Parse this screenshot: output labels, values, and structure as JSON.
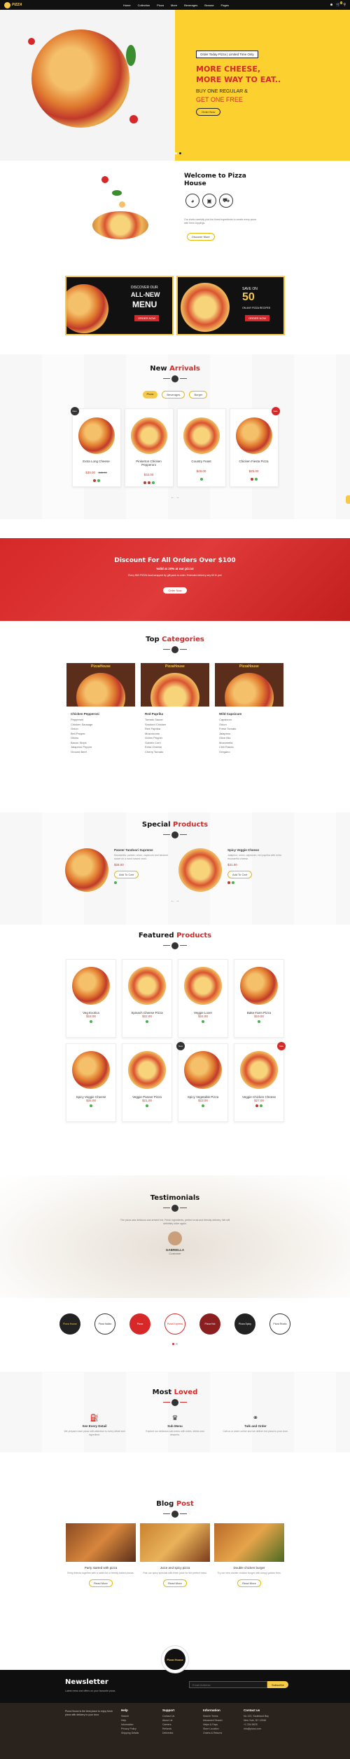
{
  "header": {
    "logo": "PIZZA",
    "nav": [
      "Home",
      "Collection",
      "Pizza",
      "More",
      "Beverages",
      "Browse",
      "Pages"
    ],
    "cart_count": "0",
    "colors": {
      "bg": "#111111",
      "accent": "#f7c948"
    }
  },
  "hero": {
    "badge": "Order Today Pizza | Limited Time Only",
    "line1": "MORE CHEESE,",
    "line2": "MORE WAY TO EAT..",
    "line3": "BUY ONE REGULAR &",
    "line4": "GET ONE FREE",
    "button": "Order Now",
    "bg": "#fcd02e"
  },
  "welcome": {
    "title": "Welcome to Pizza House",
    "text": "Our chefs carefully pick the finest ingredients to create every pizza with fresh toppings.",
    "button": "Discover More",
    "icons": [
      "pizza-slice-icon",
      "oven-icon",
      "delivery-icon"
    ]
  },
  "banners": {
    "left": {
      "l1": "DISCOVER OUR",
      "l2": "ALL-NEW",
      "l3": "MENU",
      "btn": "ORDER NOW"
    },
    "right": {
      "l1": "SAVE ON",
      "l2": "50",
      "l3": "ON ANY PIZZA RECIPES",
      "btn": "ORDER NOW"
    }
  },
  "new_arrivals": {
    "title_a": "New ",
    "title_b": "Arrivals",
    "tabs": [
      "Pizza",
      "Beverages",
      "Burger"
    ],
    "items": [
      {
        "name": "Extra Long Cheese",
        "price": "$39.00",
        "old": "$45.00",
        "badge": "New"
      },
      {
        "name": "Pinkerton Chicken Pepperoni",
        "price": "$32.00",
        "old": "",
        "badge": ""
      },
      {
        "name": "Country Feast",
        "price": "$29.00",
        "old": "",
        "badge": ""
      },
      {
        "name": "Chicken Fiesta Pizza",
        "price": "$25.00",
        "old": "",
        "badge": "Sale"
      }
    ]
  },
  "discount": {
    "title": "Discount For All Orders Over $100",
    "sub": "Valid at 20% at our pizza!",
    "text": "Every BIG PIZZA hand-wrapped by gift pack to order. Extended delivery any till 11 pm!",
    "button": "Order Now",
    "bg": "#d62828"
  },
  "categories": {
    "title_a": "Top ",
    "title_b": "Categories",
    "cols": [
      {
        "brand": "PizzaHouse",
        "name": "Chicken Pepperoni",
        "items": [
          "Pepperoni",
          "Chicken Sausage",
          "Onion",
          "Bell Pepper",
          "Olives",
          "Bacon Strips",
          "Jalapeno Pepper",
          "Ground Beef"
        ]
      },
      {
        "brand": "PizzaHouse",
        "name": "Red Paprika",
        "items": [
          "Tomato Sauce",
          "Smoked Chicken",
          "Red Paprika",
          "Mushrooms",
          "Green Pepper",
          "Golden Corn",
          "Extra Cheese",
          "Cherry Tomato"
        ]
      },
      {
        "brand": "PizzaHouse",
        "name": "Wild Capsicum",
        "items": [
          "Capsicum",
          "Onion",
          "Fresh Tomato",
          "Jalapeno",
          "Olive Mix",
          "Mozzarella",
          "Chili Flakes",
          "Oregano"
        ]
      }
    ]
  },
  "special": {
    "title_a": "Special ",
    "title_b": "Products",
    "items": [
      {
        "name": "Paneer Tandoori Supreme",
        "text": "Mozzarella, paneer, onion, capsicum and tandoori sauce on a hand tossed crust.",
        "price": "$28.00"
      },
      {
        "name": "Spicy Veggie Cheese",
        "text": "Jalapeno, onion, capsicum, red paprika with extra mozzarella cheese.",
        "price": "$31.00"
      }
    ],
    "button": "Add To Cart"
  },
  "featured": {
    "title_a": "Featured ",
    "title_b": "Products",
    "items": [
      {
        "name": "Veg Exotica",
        "price": "$18.00",
        "badge": ""
      },
      {
        "name": "Spinach Cheese Pizza",
        "price": "$22.00",
        "badge": ""
      },
      {
        "name": "Veggie Lover",
        "price": "$24.00",
        "badge": ""
      },
      {
        "name": "Bake Farm Pizza",
        "price": "$19.00",
        "badge": ""
      },
      {
        "name": "Spicy Veggie Cheese",
        "price": "$26.00",
        "badge": ""
      },
      {
        "name": "Veggie Paneer Pizza",
        "price": "$21.00",
        "badge": ""
      },
      {
        "name": "Spicy Vegetable Pizza",
        "price": "$23.00",
        "badge": "New"
      },
      {
        "name": "Veggie Chicken Cheese",
        "price": "$27.00",
        "badge": "Sale"
      }
    ]
  },
  "testimonials": {
    "title": "Testimonials",
    "quote": "The pizza was delicious and arrived hot. Fresh ingredients, perfect crust and friendly delivery. We will definitely order again.",
    "name": "GABRIELLA",
    "role": "Customer"
  },
  "brands": [
    "Pizza House",
    "Pizza Italian",
    "Pizza",
    "Pizza Express",
    "Pizza Hut",
    "Pizza Spicy",
    "Pizza Rustic"
  ],
  "most_loved": {
    "title_a": "Most ",
    "title_b": "Loved",
    "items": [
      {
        "icon": "fuel-icon",
        "name": "See Every Detail",
        "text": "We prepare each pizza with attention to every detail and ingredient."
      },
      {
        "icon": "chef-hat-icon",
        "name": "Sub Menu",
        "text": "Explore our delicious sub menu with sides, drinks and desserts."
      },
      {
        "icon": "scooter-icon",
        "name": "Talk and Order",
        "text": "Call us or order online and we deliver hot pizza to your door."
      }
    ]
  },
  "blog": {
    "title_a": "Blog ",
    "title_b": "Post",
    "posts": [
      {
        "title": "Party started with pizza",
        "text": "Bring friends together with a table full of freshly baked pizzas.",
        "btn": "Read More"
      },
      {
        "title": "Juice and spicy pizza",
        "text": "Pair our spicy specials with fresh juice for the perfect meal.",
        "btn": "Read More"
      },
      {
        "title": "Double chicken burger",
        "text": "Try our new double chicken burger with crispy golden fries.",
        "btn": "Read More"
      }
    ]
  },
  "footer_logo": "Pizza House",
  "newsletter": {
    "title": "Newsletter",
    "text": "Latest news and offers on your favourite pizza.",
    "placeholder": "Email Address",
    "button": "Subscribe"
  },
  "footer": {
    "about": "Pizza House is the best place to enjoy fresh pizza with delivery to your door.",
    "cols": [
      {
        "title": "Help",
        "links": [
          "Search",
          "Help",
          "Information",
          "Privacy Policy",
          "Shipping Details"
        ]
      },
      {
        "title": "Support",
        "links": [
          "Contact Us",
          "About Us",
          "Careers",
          "Refunds",
          "Deliveries"
        ]
      },
      {
        "title": "Information",
        "links": [
          "Search Terms",
          "Advanced Search",
          "Helps & Faqs",
          "Store Location",
          "Orders & Returns"
        ]
      },
      {
        "title": "Contact us",
        "links": [
          "No 123, Southland Bay",
          "New York, NY 12345",
          "+1 234 5678",
          "info@pizza.com"
        ]
      }
    ]
  }
}
